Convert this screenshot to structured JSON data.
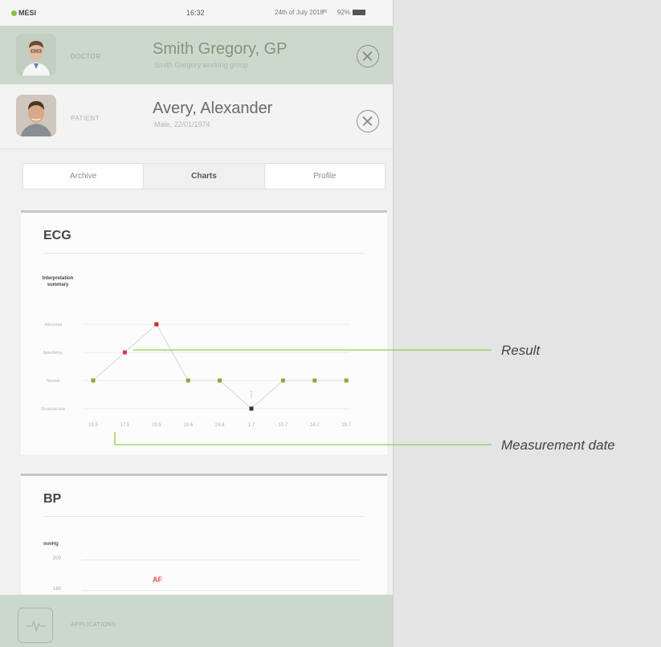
{
  "status": {
    "brand": "MESI",
    "time": "16:32",
    "date": "24th of July 2018",
    "battery": "92%"
  },
  "doctor": {
    "role": "DOCTOR",
    "name": "Smith Gregory, GP",
    "subtitle": "Smith Gregory working group"
  },
  "patient": {
    "role": "PATIENT",
    "name": "Avery, Alexander",
    "subtitle": "Male, 22/01/1974"
  },
  "tabs": [
    {
      "label": "Archive",
      "active": false
    },
    {
      "label": "Charts",
      "active": true
    },
    {
      "label": "Profile",
      "active": false
    }
  ],
  "ecg": {
    "title": "ECG",
    "chart_data": {
      "type": "line",
      "ylabel": "Interpretation summary",
      "y_categories": [
        "Sinus/unclear",
        "Normal",
        "Bpm/Arrhy.",
        "Abnormal"
      ],
      "x": [
        "15.5",
        "17.5",
        "23.5",
        "19.6",
        "24.6",
        "1.7",
        "10.7",
        "14.7",
        "18.7"
      ],
      "values": [
        "Normal",
        "Bpm/Arrhy.",
        "Abnormal",
        "Normal",
        "Normal",
        "Sinus/unclear",
        "Normal",
        "Normal",
        "Normal"
      ],
      "point_colors": [
        "#8aa83c",
        "#e0306a",
        "#d0242e",
        "#8aa83c",
        "#8aa83c",
        "#333333",
        "#8aa83c",
        "#8aa83c",
        "#8aa83c"
      ],
      "grid": true
    }
  },
  "bp": {
    "title": "BP",
    "unit": "mmHg",
    "ticks": [
      "200",
      "180"
    ],
    "annotation": "AF"
  },
  "appbar": {
    "label": "APPLICATIONS"
  },
  "callouts": {
    "result": "Result",
    "measurement_date": "Measurement date"
  },
  "colors": {
    "accent_green": "#8bbf3f",
    "header_green": "#cdd8cc",
    "callout_line": "#8fcf4f"
  }
}
